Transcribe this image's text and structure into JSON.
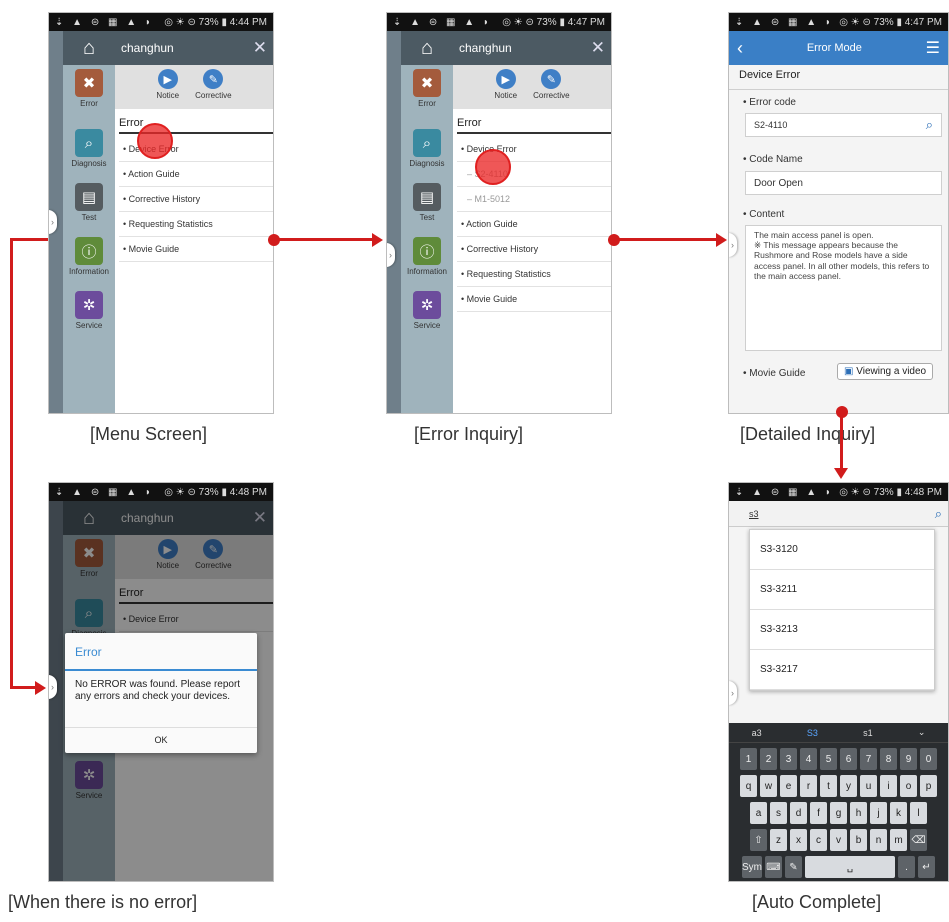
{
  "status": {
    "icons_left": "⇣ ▲ ⊜ ▦ ▲ ◗",
    "menu_time": "◎ ☀ ⊝ 73% ▮ 4:44 PM",
    "inquiry_time": "◎ ☀ ⊝ 73% ▮ 4:47 PM",
    "detail_time": "◎ ☀ ⊝ 73% ▮ 4:47 PM",
    "noerror_time": "◎ ☀ ⊝ 73% ▮ 4:48 PM",
    "auto_time": "◎ ☀ ⊝ 73% ▮ 4:48 PM"
  },
  "menu": {
    "user": "changhun",
    "nav_items": [
      "Error",
      "Diagnosis",
      "Test",
      "Information",
      "Service"
    ],
    "notice_label": "Notice",
    "corrective_label": "Corrective",
    "panel_title": "Error",
    "items": [
      "• Device Error",
      "• Action Guide",
      "• Corrective History",
      "• Requesting Statistics",
      "• Movie Guide"
    ]
  },
  "inquiry": {
    "user": "changhun",
    "nav_items": [
      "Error",
      "Diagnosis",
      "Test",
      "Information",
      "Service"
    ],
    "notice_label": "Notice",
    "corrective_label": "Corrective",
    "panel_title": "Error",
    "items": [
      "• Device Error",
      "– S2-4110",
      "– M1-5012",
      "• Action Guide",
      "• Corrective History",
      "• Requesting Statistics",
      "• Movie Guide"
    ]
  },
  "detail": {
    "title": "Error Mode",
    "section": "Device Error",
    "error_code_label": "• Error code",
    "error_code_value": "S2-4110",
    "code_name_label": "• Code Name",
    "code_name_value": "Door Open",
    "content_label": "• Content",
    "content_text": "The main access panel is open.\n※ This message appears because the Rushmore and Rose models have a side access panel. In all other models, this refers to the main access panel.",
    "movie_guide_label": "• Movie Guide",
    "video_button": "Viewing a video"
  },
  "noerror": {
    "user": "changhun",
    "nav_items": [
      "Error",
      "Diagnosis",
      "Service"
    ],
    "notice_label": "Notice",
    "corrective_label": "Corrective",
    "panel_title": "Error",
    "item": "• Device Error",
    "dialog_title": "Error",
    "dialog_message": "No ERROR was found. Please report any errors and check your devices.",
    "dialog_ok": "OK"
  },
  "autocomplete": {
    "query": "s3",
    "suggestions": [
      "S3-3120",
      "S3-3211",
      "S3-3213",
      "S3-3217"
    ],
    "predictions": [
      "a3",
      "S3",
      "s1"
    ],
    "numbers": [
      "1",
      "2",
      "3",
      "4",
      "5",
      "6",
      "7",
      "8",
      "9",
      "0"
    ],
    "row1": [
      "q",
      "w",
      "e",
      "r",
      "t",
      "y",
      "u",
      "i",
      "o",
      "p"
    ],
    "row2": [
      "a",
      "s",
      "d",
      "f",
      "g",
      "h",
      "j",
      "k",
      "l"
    ],
    "row3": [
      "z",
      "x",
      "c",
      "v",
      "b",
      "n",
      "m"
    ],
    "sym_label": "Sym"
  },
  "captions": {
    "menu": "[Menu Screen]",
    "inquiry": "[Error Inquiry]",
    "detail": "[Detailed Inquiry]",
    "noerror": "[When there is no error]",
    "autocomplete": "[Auto Complete]"
  },
  "icons": {
    "home": "home-icon",
    "close": "close-icon",
    "back": "back-icon",
    "hamburger": "hamburger-menu-icon",
    "search": "search-icon",
    "video": "video-icon"
  },
  "colors": {
    "arrow": "#d11c1c",
    "topbar": "#3a7fc6",
    "dialog_accent": "#3a8bd2"
  }
}
